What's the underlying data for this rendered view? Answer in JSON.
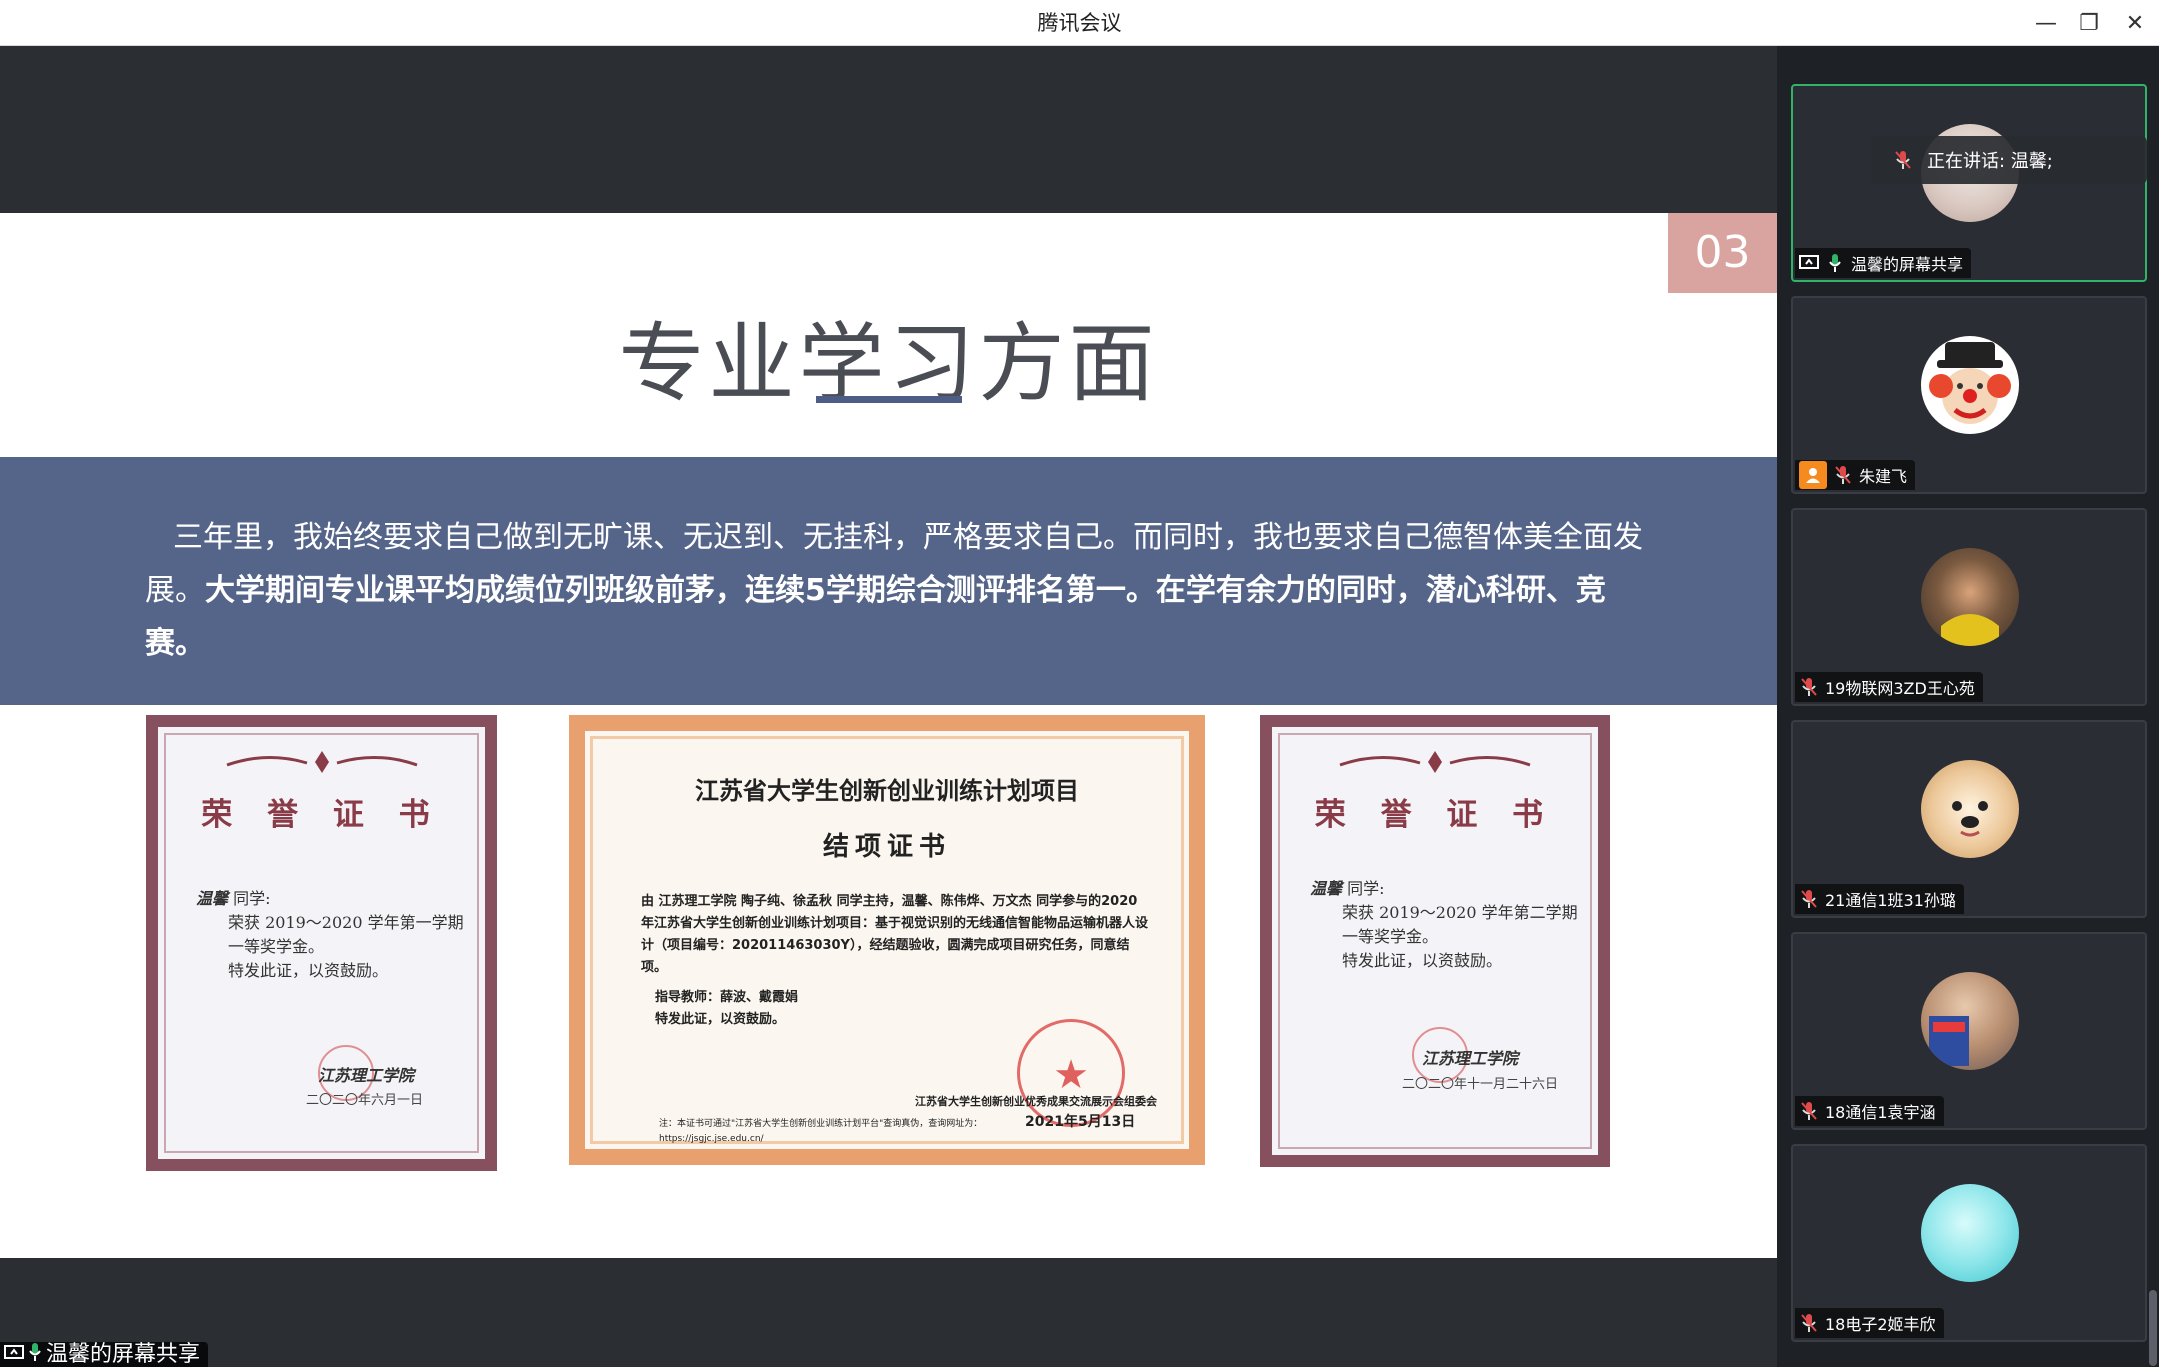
{
  "app": {
    "title": "腾讯会议",
    "controls": {
      "minimize": "—",
      "restore": "❐",
      "close": "✕"
    }
  },
  "slide": {
    "page_number": "03",
    "title": "专业学习方面",
    "paragraph_normal": "三年里，我始终要求自己做到无旷课、无迟到、无挂科，严格要求自己。而同时，我也要求自己德智体美全面发展。",
    "paragraph_bold": "大学期间专业课平均成绩位列班级前茅，连续5学期综合测评排名第一。在学有余力的同时，潜心科研、竞赛。",
    "certificates": [
      {
        "heading": "荣 誉 证 书",
        "name": "温馨",
        "salutation": "同学:",
        "line1": "荣获 2019～2020 学年第一学期一等奖学金。",
        "line2": "特发此证，以资鼓励。",
        "signer": "江苏理工学院",
        "date": "二〇二〇年六月一日"
      },
      {
        "title": "江苏省大学生创新创业训练计划项目",
        "subtitle": "结项证书",
        "body": "由 江苏理工学院 陶子纯、徐孟秋 同学主持，温馨、陈伟烨、万文杰 同学参与的2020年江苏省大学生创新创业训练计划项目：基于视觉识别的无线通信智能物品运输机器人设计（项目编号：202011463030Y），经结题验收，圆满完成项目研究任务，同意结项。",
        "advisor": "指导教师：薛波、戴霞娟",
        "encourage": "特发此证，以资鼓励。",
        "issuer": "江苏省大学生创新创业优秀成果交流展示会组委会",
        "date": "2021年5月13日",
        "note": "注：本证书可通过\"江苏省大学生创新创业训练计划平台\"查询真伪，查询网址为：https://jsgjc.jse.edu.cn/"
      },
      {
        "heading": "荣 誉 证 书",
        "name": "温馨",
        "salutation": "同学:",
        "line1": "荣获 2019～2020 学年第二学期一等奖学金。",
        "line2": "特发此证，以资鼓励。",
        "signer": "江苏理工学院",
        "date": "二〇二〇年十一月二十六日"
      }
    ]
  },
  "share_label": "温馨的屏幕共享",
  "speaking_label": "正在讲话: 温馨;",
  "participants": [
    {
      "name": "温馨的屏幕共享",
      "active": true,
      "icon": "screen-share-icon",
      "mic": "mic-on-icon",
      "avatar_color": "#e6d8d0"
    },
    {
      "name": "朱建飞",
      "active": false,
      "icon": "person-icon",
      "mic": "mic-muted-icon",
      "avatar_color": "#f2c8a0"
    },
    {
      "name": "19物联网3ZD王心苑",
      "active": false,
      "mic": "mic-muted-icon",
      "avatar_color": "#6f5a4a"
    },
    {
      "name": "21通信1班31孙璐",
      "active": false,
      "mic": "mic-muted-icon",
      "avatar_color": "#e8d2b8"
    },
    {
      "name": "18通信1袁宇涵",
      "active": false,
      "mic": "mic-muted-icon",
      "avatar_color": "#c4a18a"
    },
    {
      "name": "18电子2姬丰欣",
      "active": false,
      "mic": "mic-muted-icon",
      "avatar_color": "#8ee6ea"
    }
  ],
  "colors": {
    "band": "#556489",
    "page_badge": "#d9a4a0",
    "active_border": "#31b36a",
    "certificate_frame": "#86505e",
    "certificate_orange": "#e8a06e"
  }
}
